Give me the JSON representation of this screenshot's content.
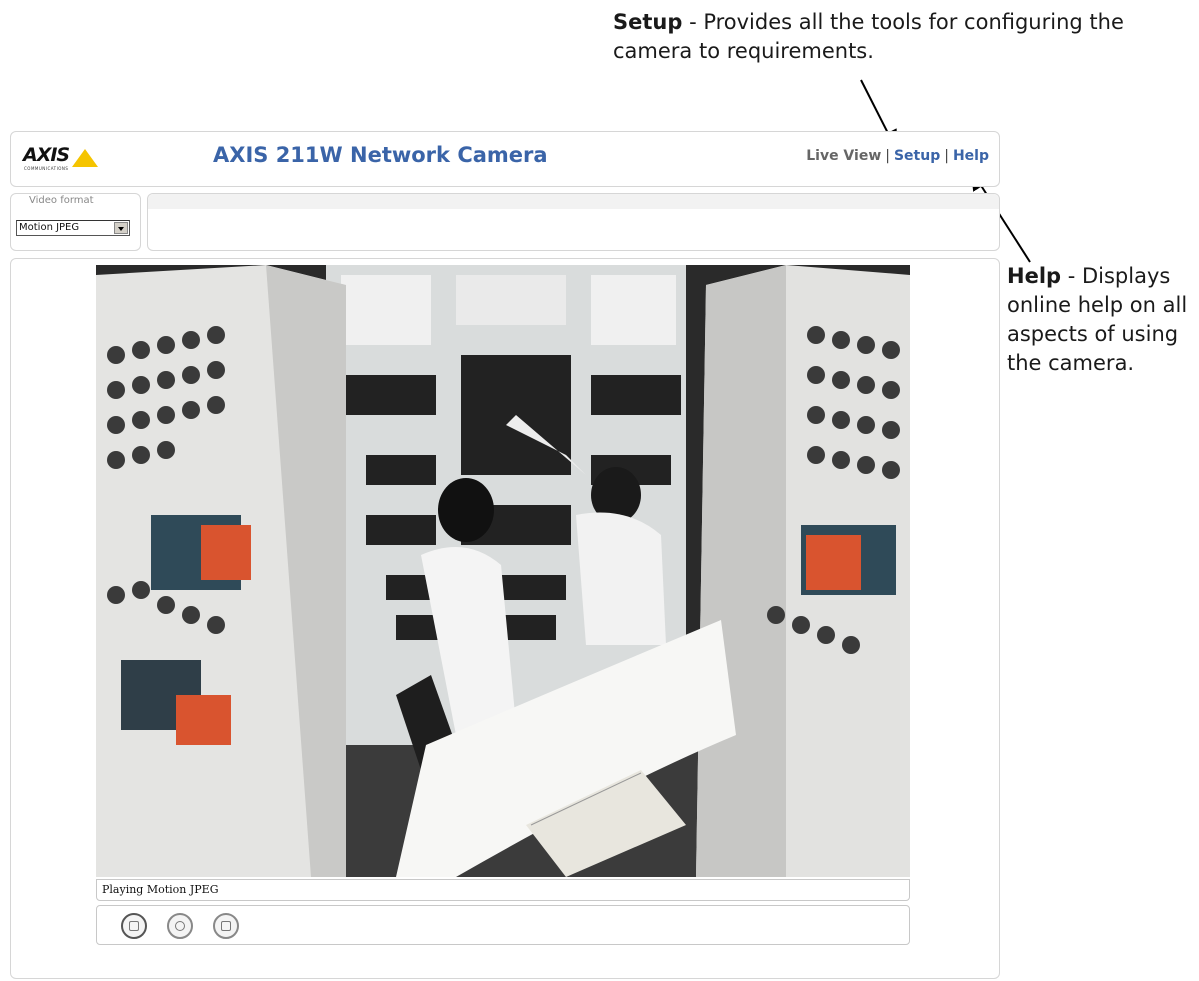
{
  "callouts": {
    "setup": {
      "term": "Setup",
      "text": " - Provides all the tools for configuring the camera to requirements."
    },
    "help": {
      "term": "Help",
      "text": " - Displays online help on all aspects of using the camera."
    }
  },
  "header": {
    "logo": "AXIS",
    "logo_sub": "COMMUNICATIONS",
    "title": "AXIS 211W Network Camera",
    "nav": {
      "live_view": "Live View",
      "separator": "|",
      "setup": "Setup",
      "help": "Help"
    }
  },
  "video_format": {
    "legend": "Video format",
    "selected": "Motion JPEG"
  },
  "status": {
    "text": "Playing Motion JPEG"
  },
  "controls": [
    {
      "name": "stop-button",
      "icon": "stop-icon"
    },
    {
      "name": "snapshot-button",
      "icon": "snapshot-icon"
    },
    {
      "name": "fullscreen-button",
      "icon": "fullscreen-icon"
    }
  ],
  "colors": {
    "title_blue": "#3a64a8",
    "logo_yellow": "#f5c400"
  }
}
